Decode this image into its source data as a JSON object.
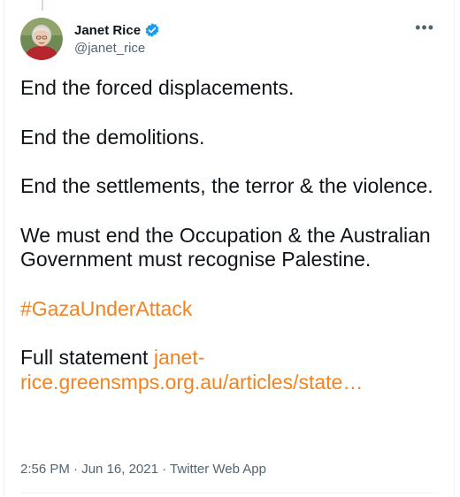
{
  "author": {
    "name": "Janet Rice",
    "handle": "@janet_rice"
  },
  "menu": {
    "more_label": "•••"
  },
  "tweet": {
    "paragraphs": [
      "End the forced displacements.",
      "End the demolitions.",
      "End the settlements, the terror & the violence.",
      "We must end the Occupation & the Australian Government must recognise Palestine."
    ],
    "hashtag": "#GazaUnderAttack",
    "statement_prefix": "Full statement",
    "statement_link": "janet-rice.greensmps.org.au/articles/state…"
  },
  "meta": {
    "time": "2:56 PM",
    "date": "Jun 16, 2021",
    "source": "Twitter Web App",
    "separator": "·"
  },
  "colors": {
    "link": "#f4821f",
    "verified": "#1d9bf0",
    "secondary_text": "#536471"
  }
}
